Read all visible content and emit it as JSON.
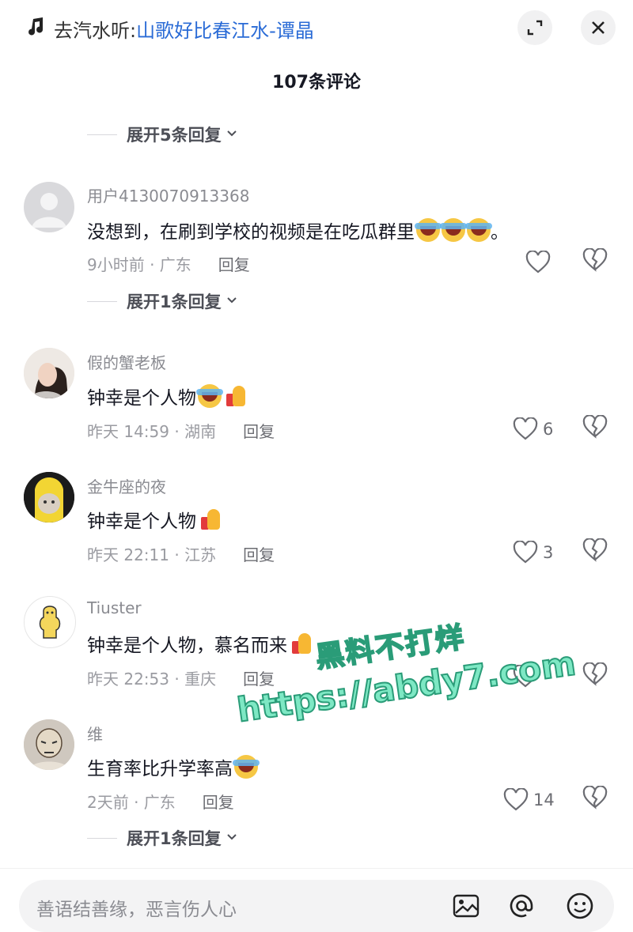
{
  "header": {
    "music_prefix": "去汽水听:",
    "song": "山歌好比春江水-谭晶",
    "comment_count": "107条评论",
    "icons": [
      "music-note-icon",
      "minimize-icon",
      "close-icon"
    ]
  },
  "expand_top": "展开5条回复",
  "comments": [
    {
      "name": "用户4130070913368",
      "text": "没想到，在刷到学校的视频是在吃瓜群里",
      "text_suffix": "。",
      "meta": "9小时前 · 广东",
      "reply": "回复",
      "likes": "",
      "expand": "展开1条回复"
    },
    {
      "name": "假的蟹老板",
      "text": "钟幸是个人物",
      "text_suffix": "",
      "meta": "昨天 14:59 · 湖南",
      "reply": "回复",
      "likes": "6",
      "expand": ""
    },
    {
      "name": "金牛座的夜",
      "text": "钟幸是个人物",
      "text_suffix": "",
      "meta": "昨天 22:11 · 江苏",
      "reply": "回复",
      "likes": "3",
      "expand": ""
    },
    {
      "name": "Tiuster",
      "text": "钟幸是个人物，慕名而来",
      "text_suffix": "",
      "meta": "昨天 22:53 · 重庆",
      "reply": "回复",
      "likes": "",
      "expand": ""
    },
    {
      "name": "维",
      "text": "生育率比升学率高",
      "text_suffix": "",
      "meta": "2天前 · 广东",
      "reply": "回复",
      "likes": "14",
      "expand": "展开1条回复"
    }
  ],
  "watermark": {
    "line1": "黑料不打烊",
    "line2": "https://abdy7.com"
  },
  "input": {
    "placeholder": "善语结善缘，恶言伤人心"
  },
  "colors": {
    "link": "#2a6bd6",
    "watermark": "#7ee8c4"
  }
}
